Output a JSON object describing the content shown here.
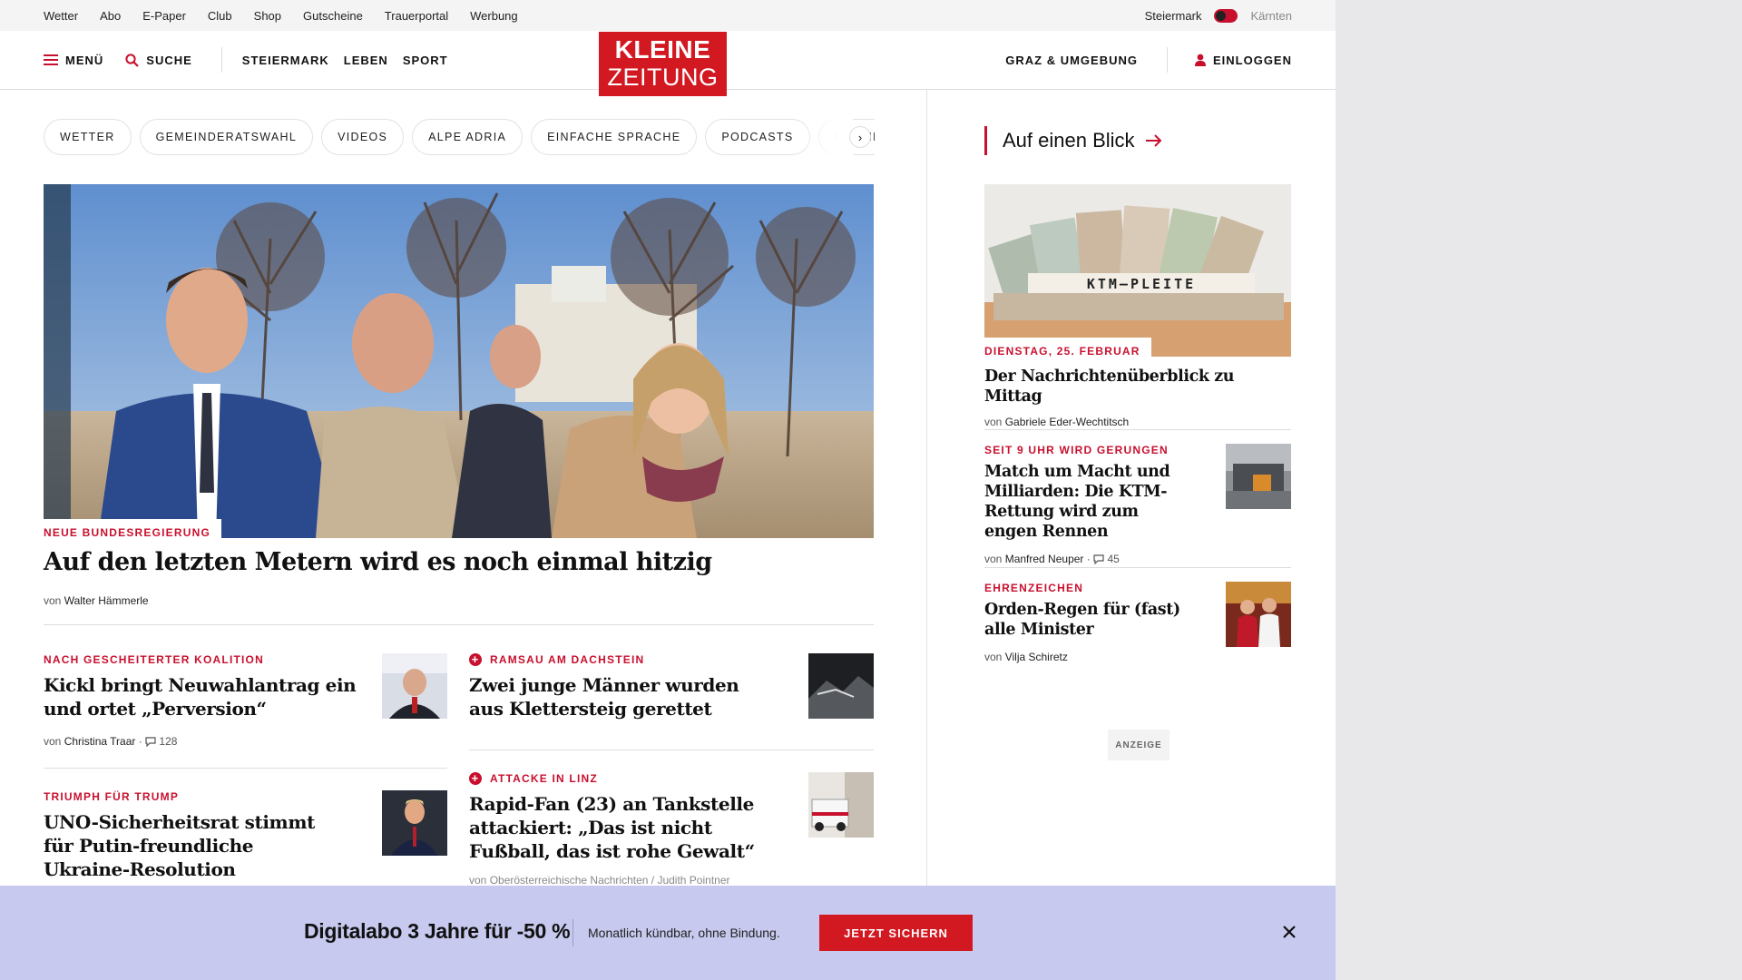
{
  "utility": {
    "links": [
      "Wetter",
      "Abo",
      "E-Paper",
      "Club",
      "Shop",
      "Gutscheine",
      "Trauerportal",
      "Werbung"
    ],
    "region_active": "Steiermark",
    "region_inactive": "Kärnten"
  },
  "header": {
    "menu_label": "MENÜ",
    "search_label": "SUCHE",
    "nav": [
      "STEIERMARK",
      "LEBEN",
      "SPORT"
    ],
    "logo_line1": "KLEINE",
    "logo_line2": "ZEITUNG",
    "local_label": "GRAZ & UMGEBUNG",
    "login_label": "EINLOGGEN",
    "brand_color": "#d21921"
  },
  "pills": [
    "WETTER",
    "GEMEINDERATSWAHL",
    "VIDEOS",
    "ALPE ADRIA",
    "EINFACHE SPRACHE",
    "PODCASTS",
    "KLEINE KI"
  ],
  "hero": {
    "kicker": "NEUE BUNDESREGIERUNG",
    "title": "Auf den letzten Metern wird es noch einmal hitzig",
    "by": "von",
    "author": "Walter Hämmerle"
  },
  "articles": [
    {
      "kicker": "NACH GESCHEITERTER KOALITION",
      "title": "Kickl bringt Neuwahlantrag ein und ortet „Perversion“",
      "by": "von",
      "author": "Christina Traar",
      "comments": "128",
      "plus": false
    },
    {
      "kicker": "RAMSAU AM DACHSTEIN",
      "title": "Zwei junge Männer wurden aus Klettersteig gerettet",
      "plus": true
    },
    {
      "kicker": "TRIUMPH FÜR TRUMP",
      "title": "UNO-Sicherheitsrat stimmt für Putin-freundliche Ukraine-Resolution",
      "plus": false
    },
    {
      "kicker": "ATTACKE IN LINZ",
      "title": "Rapid-Fan (23) an Tankstelle attackiert: „Das ist nicht Fußball, das ist rohe Gewalt“",
      "by": "von",
      "author": "Oberösterreichische Nachrichten / Judith Pointner",
      "plus": true
    }
  ],
  "sidebar": {
    "heading": "Auf einen Blick",
    "image_text": "KTM—PLEITE",
    "items": [
      {
        "kicker": "DIENSTAG, 25. FEBRUAR",
        "title": "Der Nachrichtenüberblick zu Mittag",
        "by": "von",
        "author": "Gabriele Eder-Wechtitsch"
      },
      {
        "kicker": "SEIT 9 UHR WIRD GERUNGEN",
        "title": "Match um Macht und Milliarden: Die KTM-Rettung wird zum engen Rennen",
        "by": "von",
        "author": "Manfred Neuper",
        "comments": "45"
      },
      {
        "kicker": "EHRENZEICHEN",
        "title": "Orden-Regen für (fast) alle Minister",
        "by": "von",
        "author": "Vilja Schiretz"
      }
    ],
    "ad_label": "ANZEIGE"
  },
  "promo": {
    "title": "Digitalabo 3 Jahre für -50 %",
    "subtitle": "Monatlich kündbar, ohne Bindung.",
    "button": "JETZT SICHERN",
    "background": "#c7c9ee"
  }
}
